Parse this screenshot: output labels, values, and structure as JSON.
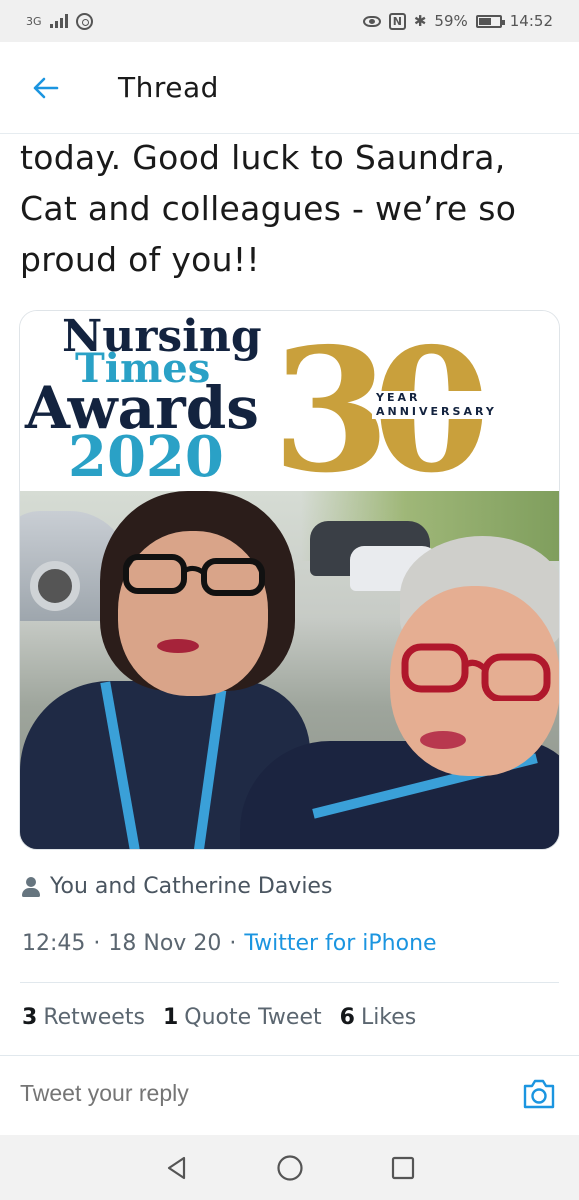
{
  "status_bar": {
    "network": "3G",
    "battery_percent": "59%",
    "time": "14:52"
  },
  "header": {
    "title": "Thread",
    "back_icon": "arrow-left-icon"
  },
  "tweet": {
    "text_lines": [
      "today. Good luck to Saundra,",
      "Cat and colleagues - we’re so",
      "proud of you!!"
    ],
    "media": {
      "logo_lines": [
        "Nursing",
        "Times",
        "Awards",
        "2020"
      ],
      "anniversary_number": "30",
      "anniversary_lines": [
        "YEAR",
        "ANNIVERSARY"
      ]
    },
    "liked_by": "You and Catherine Davies",
    "time": "12:45",
    "date": "18 Nov 20",
    "separator": "·",
    "source": "Twitter for iPhone",
    "stats": {
      "retweets_count": "3",
      "retweets_label": "Retweets",
      "quotes_count": "1",
      "quotes_label": "Quote Tweet",
      "likes_count": "6",
      "likes_label": "Likes"
    }
  },
  "reply": {
    "placeholder": "Tweet your reply",
    "camera_icon": "camera-icon"
  },
  "colors": {
    "accent": "#1b95e0",
    "logo_navy": "#13233f",
    "logo_blue": "#2aa1c6",
    "logo_gold": "#c9a03c"
  }
}
